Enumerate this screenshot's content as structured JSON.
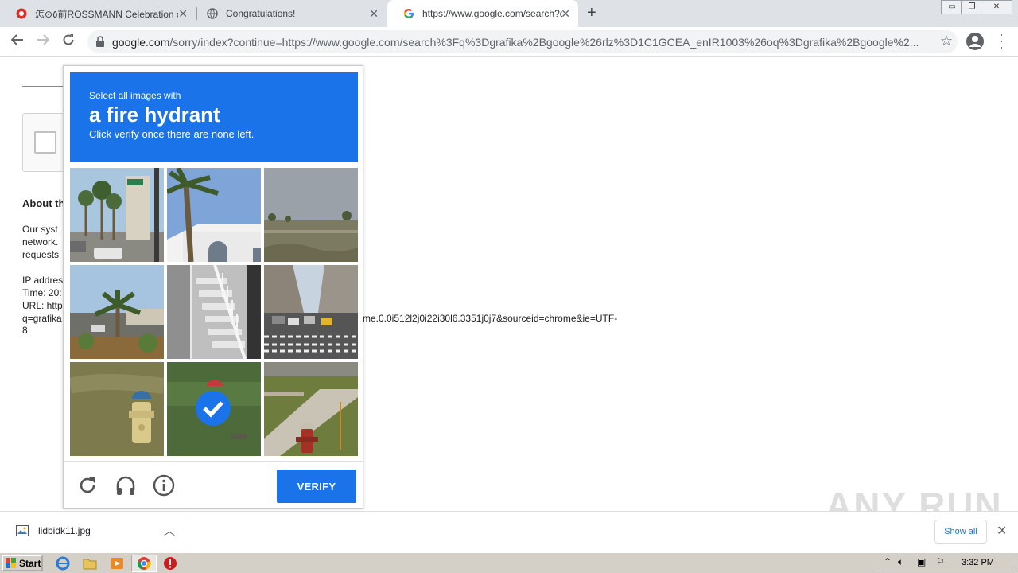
{
  "tabs": [
    {
      "title": "ROSSMANN Celebration of bi",
      "prefix": "怎⊙٥前",
      "active": false
    },
    {
      "title": "Congratulations!",
      "active": false
    },
    {
      "title": "https://www.google.com/search?q=",
      "active": true
    }
  ],
  "toolbar": {
    "url_host": "google.com",
    "url_path": "/sorry/index?continue=https://www.google.com/search%3Fq%3Dgrafika%2Bgoogle%26rlz%3D1C1GCEA_enIR1003%26oq%3Dgrafika%2Bgoogle%2..."
  },
  "page": {
    "about_title": "About th",
    "about_lines": [
      "Our syst",
      "network.",
      "requests"
    ],
    "ip_lines": [
      "IP addres",
      "Time: 20:",
      "URL: http",
      "q=grafika"
    ],
    "url_tail": "me.0.0i512l2j0i22i30l6.3351j0j7&sourceid=chrome&ie=UTF-",
    "url_tail2": "8"
  },
  "captcha": {
    "instruction_small": "Select all images with",
    "target": "a fire hydrant",
    "instruction_sub": "Click verify once there are none left.",
    "verify_label": "VERIFY",
    "tiles": [
      {
        "scene": "palm-street",
        "selected": false
      },
      {
        "scene": "palm-building",
        "selected": false
      },
      {
        "scene": "open-field",
        "selected": false
      },
      {
        "scene": "palm-lot",
        "selected": false
      },
      {
        "scene": "stairs",
        "selected": false
      },
      {
        "scene": "city-street",
        "selected": false
      },
      {
        "scene": "hydrant-yellow",
        "selected": false
      },
      {
        "scene": "hydrant-selected",
        "selected": true
      },
      {
        "scene": "hydrant-red-sidewalk",
        "selected": false
      }
    ]
  },
  "downloads": {
    "file_name": "lidbidk11.jpg",
    "show_all": "Show all"
  },
  "watermark": "ANY RUN",
  "taskbar": {
    "start_label": "Start",
    "clock": "3:32 PM"
  },
  "colors": {
    "accent": "#1a73e8",
    "tabstrip": "#dee1e6",
    "taskbar": "#d4d0c8"
  }
}
